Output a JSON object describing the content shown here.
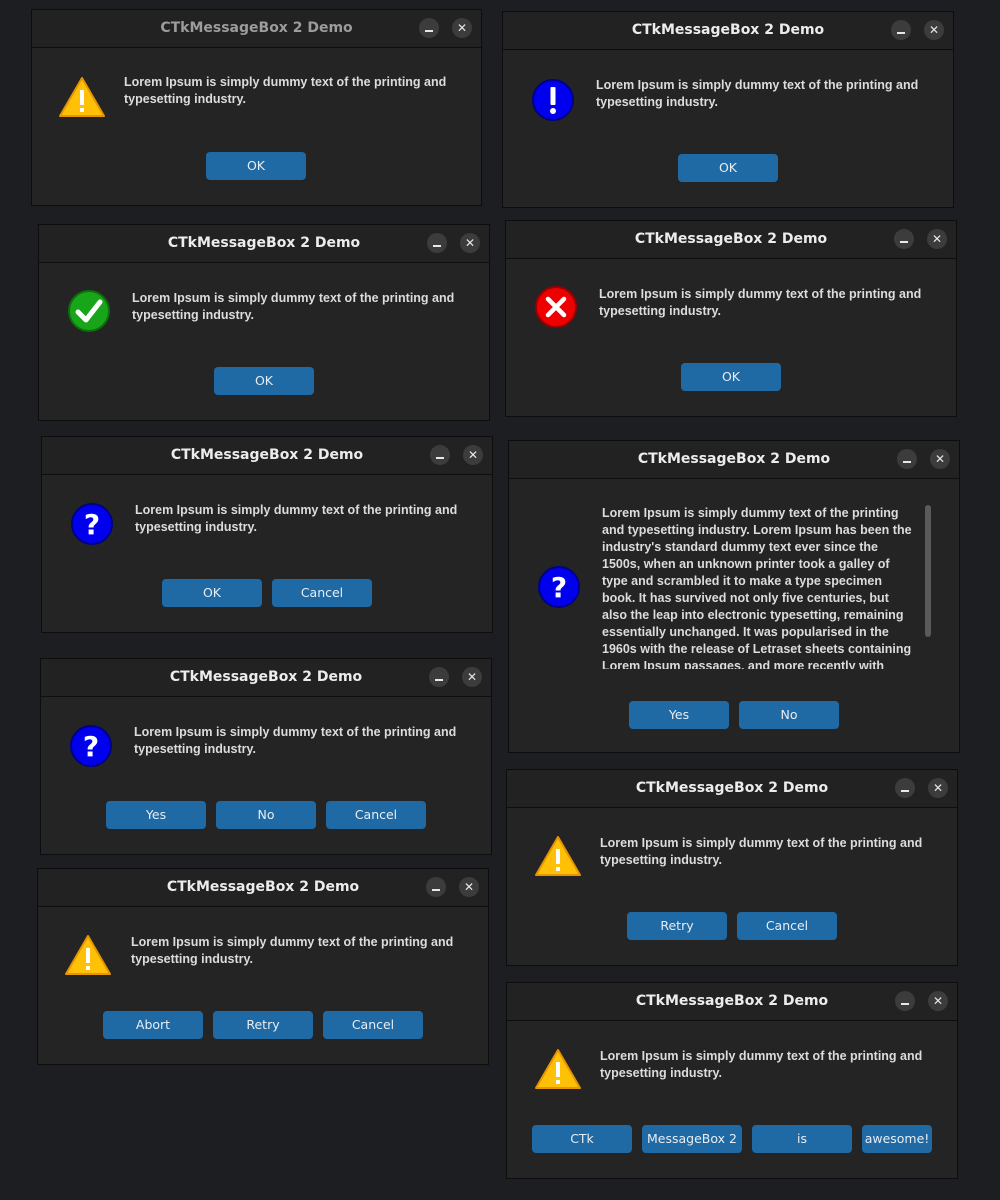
{
  "dialogs": [
    {
      "title": "CTkMessageBox 2 Demo",
      "icon": "warning-icon",
      "message": "Lorem Ipsum is simply dummy text of the printing and typesetting industry.",
      "buttons": [
        "OK"
      ]
    },
    {
      "title": "CTkMessageBox 2 Demo",
      "icon": "info-icon",
      "message": "Lorem Ipsum is simply dummy text of the printing and typesetting industry.",
      "buttons": [
        "OK"
      ]
    },
    {
      "title": "CTkMessageBox 2 Demo",
      "icon": "check-icon",
      "message": "Lorem Ipsum is simply dummy text of the printing and typesetting industry.",
      "buttons": [
        "OK"
      ]
    },
    {
      "title": "CTkMessageBox 2 Demo",
      "icon": "error-icon",
      "message": "Lorem Ipsum is simply dummy text of the printing and typesetting industry.",
      "buttons": [
        "OK"
      ]
    },
    {
      "title": "CTkMessageBox 2 Demo",
      "icon": "question-icon",
      "message": "Lorem Ipsum is simply dummy text of the printing and typesetting industry.",
      "buttons": [
        "OK",
        "Cancel"
      ]
    },
    {
      "title": "CTkMessageBox 2 Demo",
      "icon": "question-icon",
      "message": "Lorem Ipsum is simply dummy text of the printing and typesetting industry. Lorem Ipsum has been the industry's standard dummy text ever since the 1500s, when an unknown printer took a galley of type and scrambled it to make a type specimen book. It has survived not only five centuries, but also the leap into electronic typesetting, remaining essentially unchanged. It was popularised in the 1960s with the release of Letraset sheets containing Lorem Ipsum passages, and more recently with desktop publishing",
      "buttons": [
        "Yes",
        "No"
      ]
    },
    {
      "title": "CTkMessageBox 2 Demo",
      "icon": "question-icon",
      "message": "Lorem Ipsum is simply dummy text of the printing and typesetting industry.",
      "buttons": [
        "Yes",
        "No",
        "Cancel"
      ]
    },
    {
      "title": "CTkMessageBox 2 Demo",
      "icon": "warning-icon",
      "message": "Lorem Ipsum is simply dummy text of the printing and typesetting industry.",
      "buttons": [
        "Retry",
        "Cancel"
      ]
    },
    {
      "title": "CTkMessageBox 2 Demo",
      "icon": "warning-icon",
      "message": "Lorem Ipsum is simply dummy text of the printing and typesetting industry.",
      "buttons": [
        "Abort",
        "Retry",
        "Cancel"
      ]
    },
    {
      "title": "CTkMessageBox 2 Demo",
      "icon": "warning-icon",
      "message": "Lorem Ipsum is simply dummy text of the printing and typesetting industry.",
      "buttons": [
        "CTk",
        "MessageBox 2",
        "is",
        "awesome!"
      ]
    }
  ],
  "colors": {
    "accent": "#1f6aa5",
    "warning": "#ffc107",
    "info": "#0000ee",
    "success": "#19a519",
    "error": "#ee0000"
  }
}
